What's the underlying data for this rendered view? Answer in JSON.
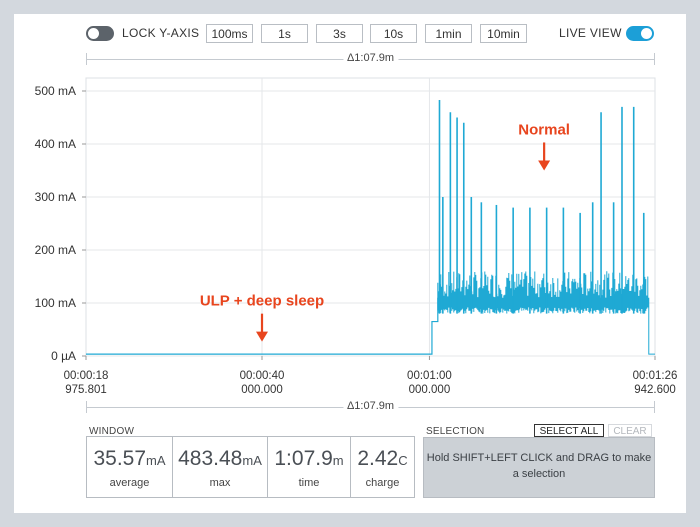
{
  "toolbar": {
    "lock_label": "LOCK Y-AXIS",
    "lock_on": false,
    "windows": [
      "100ms",
      "1s",
      "3s",
      "10s",
      "1min",
      "10min"
    ],
    "live_label": "LIVE VIEW",
    "live_on": true
  },
  "delta_top": "Δ1:07.9m",
  "delta_bottom": "Δ1:07.9m",
  "chart_data": {
    "type": "line",
    "y_ticks": [
      "500 mA",
      "400 mA",
      "300 mA",
      "200 mA",
      "100 mA",
      "0 µA"
    ],
    "ylim": [
      0,
      500
    ],
    "x_ticks": [
      {
        "time": "00:00:18",
        "sub": "975.801"
      },
      {
        "time": "00:00:40",
        "sub": "000.000"
      },
      {
        "time": "00:01:00",
        "sub": "000.000"
      },
      {
        "time": "00:01:26",
        "sub": "942.600"
      }
    ],
    "xlim_s": [
      18.976,
      86.943
    ],
    "grid": true,
    "line_color": "#1fa9d4",
    "annotations": [
      {
        "text": "ULP + deep sleep",
        "x_s": 40,
        "y": 95
      },
      {
        "text": "Normal",
        "x_s": 73.7,
        "y": 418
      }
    ],
    "series": [
      {
        "segments": [
          {
            "x_start": 18.976,
            "x_end": 60.3,
            "value": 3.5
          },
          {
            "x_start": 60.3,
            "x_end": 61.0,
            "value": 65
          },
          {
            "x_start": 61.0,
            "x_end": 86.2,
            "baseline": 80,
            "band_high": 160,
            "typical": 110
          },
          {
            "x_start": 86.2,
            "x_end": 86.943,
            "value": 3.5
          }
        ],
        "spikes": [
          {
            "x": 61.2,
            "value": 483
          },
          {
            "x": 61.6,
            "value": 300
          },
          {
            "x": 62.5,
            "value": 460
          },
          {
            "x": 63.3,
            "value": 450
          },
          {
            "x": 64.1,
            "value": 440
          },
          {
            "x": 65.0,
            "value": 300
          },
          {
            "x": 66.2,
            "value": 290
          },
          {
            "x": 68.0,
            "value": 285
          },
          {
            "x": 70.0,
            "value": 280
          },
          {
            "x": 72.0,
            "value": 280
          },
          {
            "x": 74.0,
            "value": 280
          },
          {
            "x": 76.0,
            "value": 280
          },
          {
            "x": 78.0,
            "value": 270
          },
          {
            "x": 79.5,
            "value": 290
          },
          {
            "x": 80.5,
            "value": 460
          },
          {
            "x": 82.0,
            "value": 290
          },
          {
            "x": 83.0,
            "value": 470
          },
          {
            "x": 84.4,
            "value": 470
          },
          {
            "x": 85.6,
            "value": 270
          }
        ]
      }
    ]
  },
  "window": {
    "title": "WINDOW",
    "stats": [
      {
        "value": "35.57",
        "unit": "mA",
        "caption": "average"
      },
      {
        "value": "483.48",
        "unit": "mA",
        "caption": "max"
      },
      {
        "value": "1:07.9",
        "unit": "m",
        "caption": "time"
      },
      {
        "value": "2.42",
        "unit": "C",
        "caption": "charge"
      }
    ]
  },
  "selection": {
    "title": "SELECTION",
    "select_all": "SELECT ALL",
    "clear": "CLEAR",
    "hint": "Hold SHIFT+LEFT CLICK and DRAG to make a selection"
  }
}
